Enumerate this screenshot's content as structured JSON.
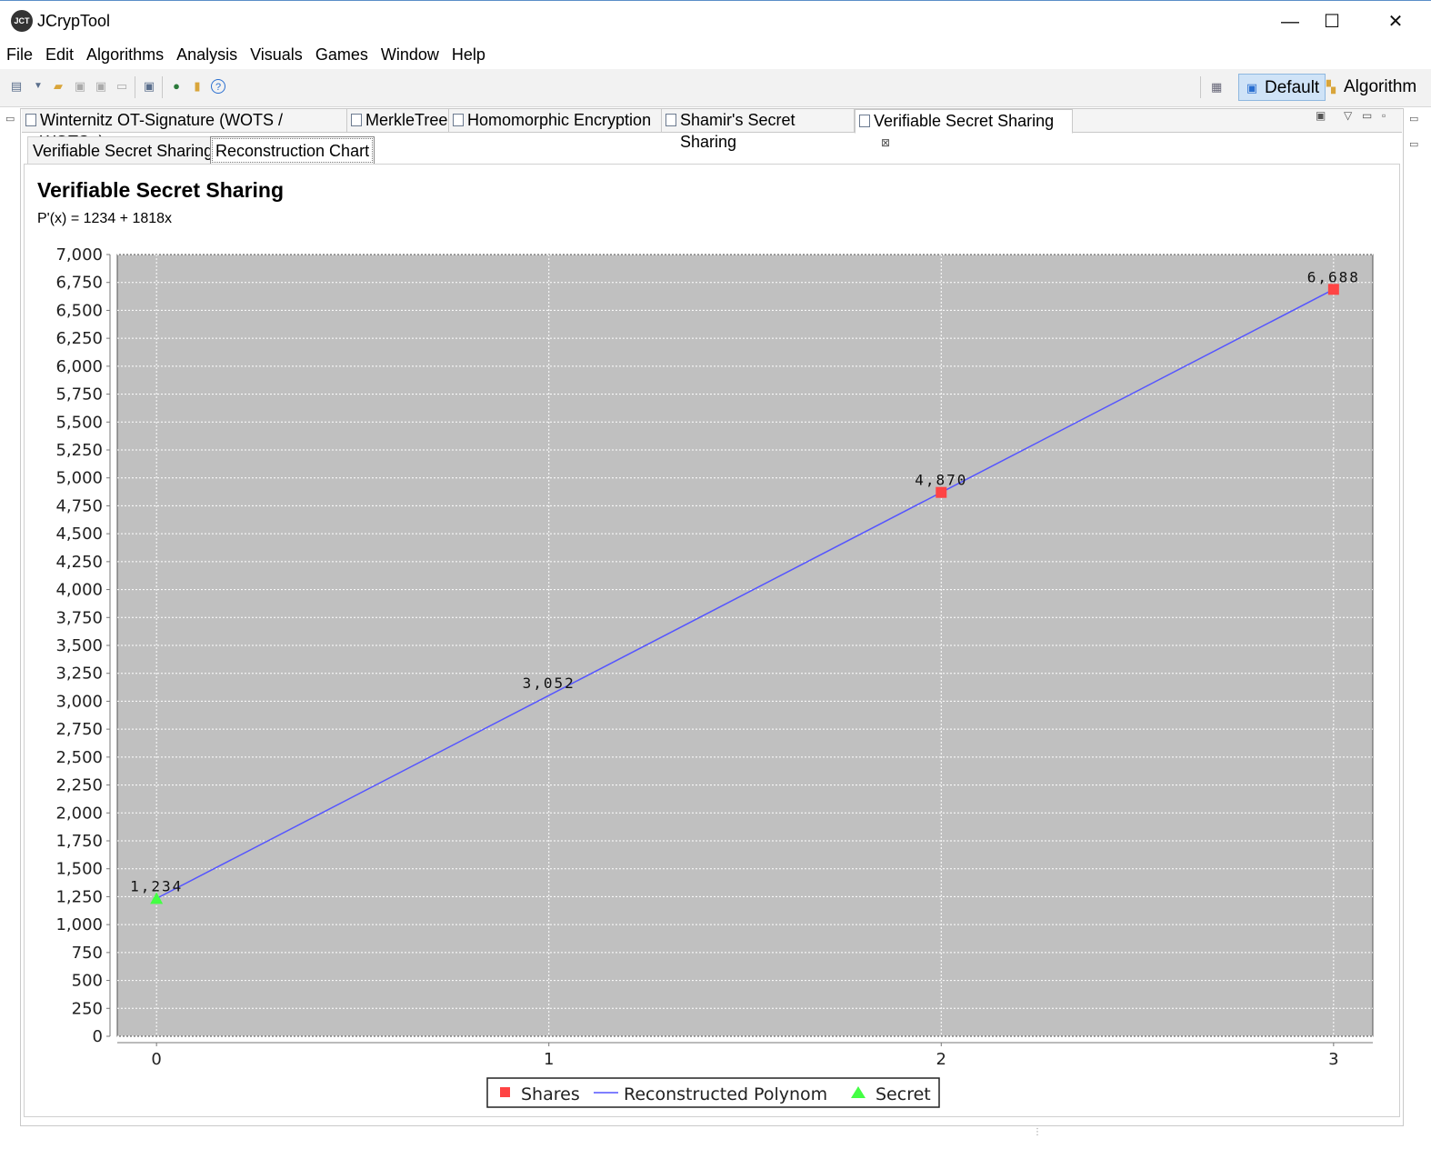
{
  "window": {
    "title": "JCrypTool",
    "logo_text": "JCT",
    "minimize": "—",
    "maximize": "☐",
    "close": "✕"
  },
  "menu": [
    "File",
    "Edit",
    "Algorithms",
    "Analysis",
    "Visuals",
    "Games",
    "Window",
    "Help"
  ],
  "perspectives": {
    "default_label": "Default",
    "algorithm_label": "Algorithm"
  },
  "editor_tabs": [
    {
      "label": "Winternitz OT-Signature (WOTS / WOTS+)"
    },
    {
      "label": "MerkleTree"
    },
    {
      "label": "Homomorphic Encryption"
    },
    {
      "label": "Shamir's Secret Sharing"
    },
    {
      "label": "Verifiable Secret Sharing",
      "active": true,
      "close": "⊠"
    }
  ],
  "inner_tabs": [
    {
      "label": "Verifiable Secret Sharing"
    },
    {
      "label": "Reconstruction Chart",
      "active": true
    }
  ],
  "chart": {
    "title": "Verifiable Secret Sharing",
    "subtitle": "P'(x) = 1234 + 1818x"
  },
  "chart_data": {
    "type": "line",
    "x_ticks": [
      "0",
      "1",
      "2",
      "3"
    ],
    "y_ticks": [
      "0",
      "250",
      "500",
      "750",
      "1,000",
      "1,250",
      "1,500",
      "1,750",
      "2,000",
      "2,250",
      "2,500",
      "2,750",
      "3,000",
      "3,250",
      "3,500",
      "3,750",
      "4,000",
      "4,250",
      "4,500",
      "4,750",
      "5,000",
      "5,250",
      "5,500",
      "5,750",
      "6,000",
      "6,250",
      "6,500",
      "6,750",
      "7,000"
    ],
    "xlim": [
      -0.1,
      3.1
    ],
    "ylim": [
      0,
      7000
    ],
    "grid": true,
    "legend_placement": "bottom-center",
    "series": [
      {
        "name": "Shares",
        "kind": "points",
        "marker": "square",
        "color": "#ff4444",
        "x": [
          2,
          3
        ],
        "y": [
          4870,
          6688
        ]
      },
      {
        "name": "Reconstructed Polynom",
        "kind": "line",
        "color": "#5555ff",
        "x": [
          0,
          1,
          2,
          3
        ],
        "y": [
          1234,
          3052,
          4870,
          6688
        ]
      },
      {
        "name": "Secret",
        "kind": "points",
        "marker": "triangle",
        "color": "#44ff44",
        "x": [
          0
        ],
        "y": [
          1234
        ]
      }
    ],
    "data_labels": [
      {
        "x": 0,
        "y": 1234,
        "text": "1,234"
      },
      {
        "x": 1,
        "y": 3052,
        "text": "3,052"
      },
      {
        "x": 2,
        "y": 4870,
        "text": "4,870"
      },
      {
        "x": 3,
        "y": 6688,
        "text": "6,688"
      }
    ],
    "plot_background": "#c0c0c0"
  }
}
